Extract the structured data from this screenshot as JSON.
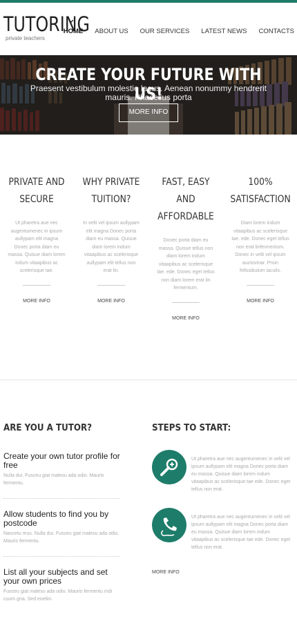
{
  "brand": {
    "title": "TUTORING",
    "subtitle": "private teachers",
    "accent": "#1e7d6a"
  },
  "nav": {
    "items": [
      "HOME",
      "ABOUT US",
      "OUR SERVICES",
      "LATEST NEWS",
      "CONTACTS"
    ],
    "active_icon": "chevron-down-icon"
  },
  "hero": {
    "title": "CREATE YOUR FUTURE WITH US!",
    "text": "Praesent vestibulum molestie lacus. Aenean nonummy hendrerit mauris. Phasellus porta",
    "button": "MORE INFO"
  },
  "features": [
    {
      "title": "PRIVATE AND SECURE",
      "text": "Ut pharetra aue nec augentumenec in ipsum aullypam elit magna Donec porta diam eu massa. Quisue diam lorem indum vitaapibus ac scelerisque tae.",
      "more": "MORE INFO"
    },
    {
      "title": "WHY PRIVATE TUITION?",
      "text": "In velit vel ipsum aullypam elit magna Donec porta diam eu massa. Quisue diam lorem indum vitaapibus ac scelerisque aullypam elit tellus non erat lin.",
      "more": "MORE INFO"
    },
    {
      "title": "FAST, EASY AND AFFORDABLE",
      "text": "Donec porta diam eu massa. Quisue tellus non diam lorem indum vitaapibus ac scelerisque tae. ede. Donec eget tellus non diam lorem erat lin fermentum.",
      "more": "MORE INFO"
    },
    {
      "title": "100% SATISFACTION",
      "text": "Diam lorem indum vitaapibus ac scelerisque tae. ede. Donec eget tellus non erat linfermentum. Donec in velit vel ipsum auctovinar. Proin fellssibulum iaculis.",
      "more": "MORE INFO"
    }
  ],
  "tutor": {
    "heading": "ARE YOU A TUTOR?",
    "steps": [
      {
        "title": "Create your own tutor profile for free",
        "text": "Nulla dui. Fusceu giat malesu ada odio. Mauris fermentu."
      },
      {
        "title": "Allow students to find you by postcode",
        "text": "Nascetu mus. Nulla dui. Fusceu giat malesu ada odio. Mauris fermentu."
      },
      {
        "title": "List all your subjects and set your own prices",
        "text": "Fusceu giat malesu ada odio. Mauris fermentu mdi cuum gna. Sed eoeliin."
      }
    ]
  },
  "start": {
    "heading": "STEPS TO START:",
    "items": [
      {
        "icon": "search-icon",
        "text": "Ut pharetra aue nec augentumenec in velit vel ipsum aullypam elit magna Donec porta diam eu massa. Quisue diam lorem indum vitaapibus ac scelerisque tae ede. Donec eget tellus non erat."
      },
      {
        "icon": "phone-icon",
        "text": "Ut pharetra aue nec augentumenec in velit vel ipsum aullypam elit magna Donec porta diam eu massa. Quisue diam lorem indum vitaapibus ac scelerisque tae ede. Donec eget tellus non erat."
      }
    ],
    "more": "MORE INFO"
  }
}
